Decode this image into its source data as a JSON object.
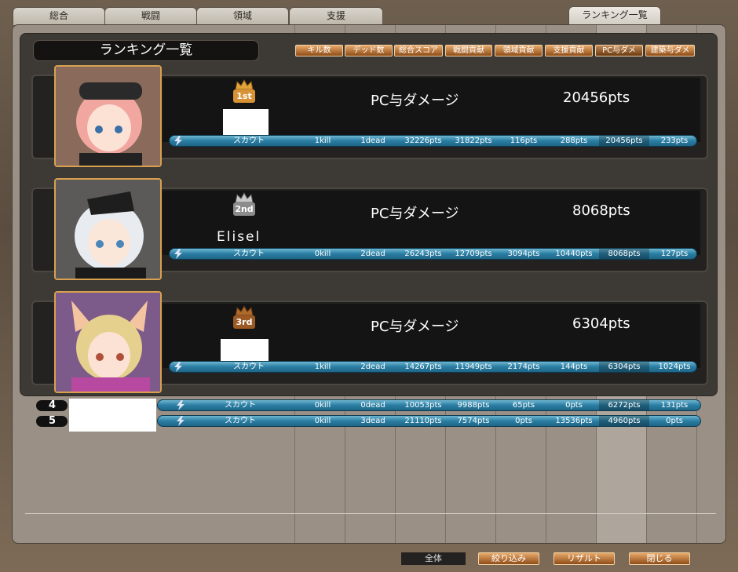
{
  "tabs": [
    {
      "label": "総合"
    },
    {
      "label": "戦闘"
    },
    {
      "label": "領域"
    },
    {
      "label": "支援"
    },
    {
      "label": "ランキング一覧"
    }
  ],
  "panel_title": "ランキング一覧",
  "column_buttons": [
    "キル数",
    "デッド数",
    "総合スコア",
    "戦闘貢献",
    "領域貢献",
    "支援貢献",
    "PC与ダメ",
    "建築与ダメ"
  ],
  "selected_column": "PC与ダメ",
  "top_entries": [
    {
      "rank_label": "1st",
      "name": "",
      "stat_label": "PC与ダメージ",
      "stat_value": "20456pts",
      "class": "スカウト",
      "cells": [
        "1kill",
        "1dead",
        "32226pts",
        "31822pts",
        "116pts",
        "288pts",
        "20456pts",
        "233pts"
      ]
    },
    {
      "rank_label": "2nd",
      "name": "Elisel",
      "stat_label": "PC与ダメージ",
      "stat_value": "8068pts",
      "class": "スカウト",
      "cells": [
        "0kill",
        "2dead",
        "26243pts",
        "12709pts",
        "3094pts",
        "10440pts",
        "8068pts",
        "127pts"
      ]
    },
    {
      "rank_label": "3rd",
      "name": "",
      "stat_label": "PC与ダメージ",
      "stat_value": "6304pts",
      "class": "スカウト",
      "cells": [
        "1kill",
        "2dead",
        "14267pts",
        "11949pts",
        "2174pts",
        "144pts",
        "6304pts",
        "1024pts"
      ]
    }
  ],
  "other_entries": [
    {
      "rank": "4",
      "class": "スカウト",
      "cells": [
        "0kill",
        "0dead",
        "10053pts",
        "9988pts",
        "65pts",
        "0pts",
        "6272pts",
        "131pts"
      ]
    },
    {
      "rank": "5",
      "class": "スカウト",
      "cells": [
        "0kill",
        "3dead",
        "21110pts",
        "7574pts",
        "0pts",
        "13536pts",
        "4960pts",
        "0pts"
      ]
    }
  ],
  "footer": {
    "scope_label": "全体",
    "filter_button": "絞り込み",
    "result_button": "リザルト",
    "close_button": "閉じる"
  },
  "colors": {
    "bar": "#2a7ea3",
    "button": "#b26a2c",
    "gold_crown": "#e0a43a",
    "silver_crown": "#c8c8c8",
    "bronze_crown": "#b0692c"
  }
}
